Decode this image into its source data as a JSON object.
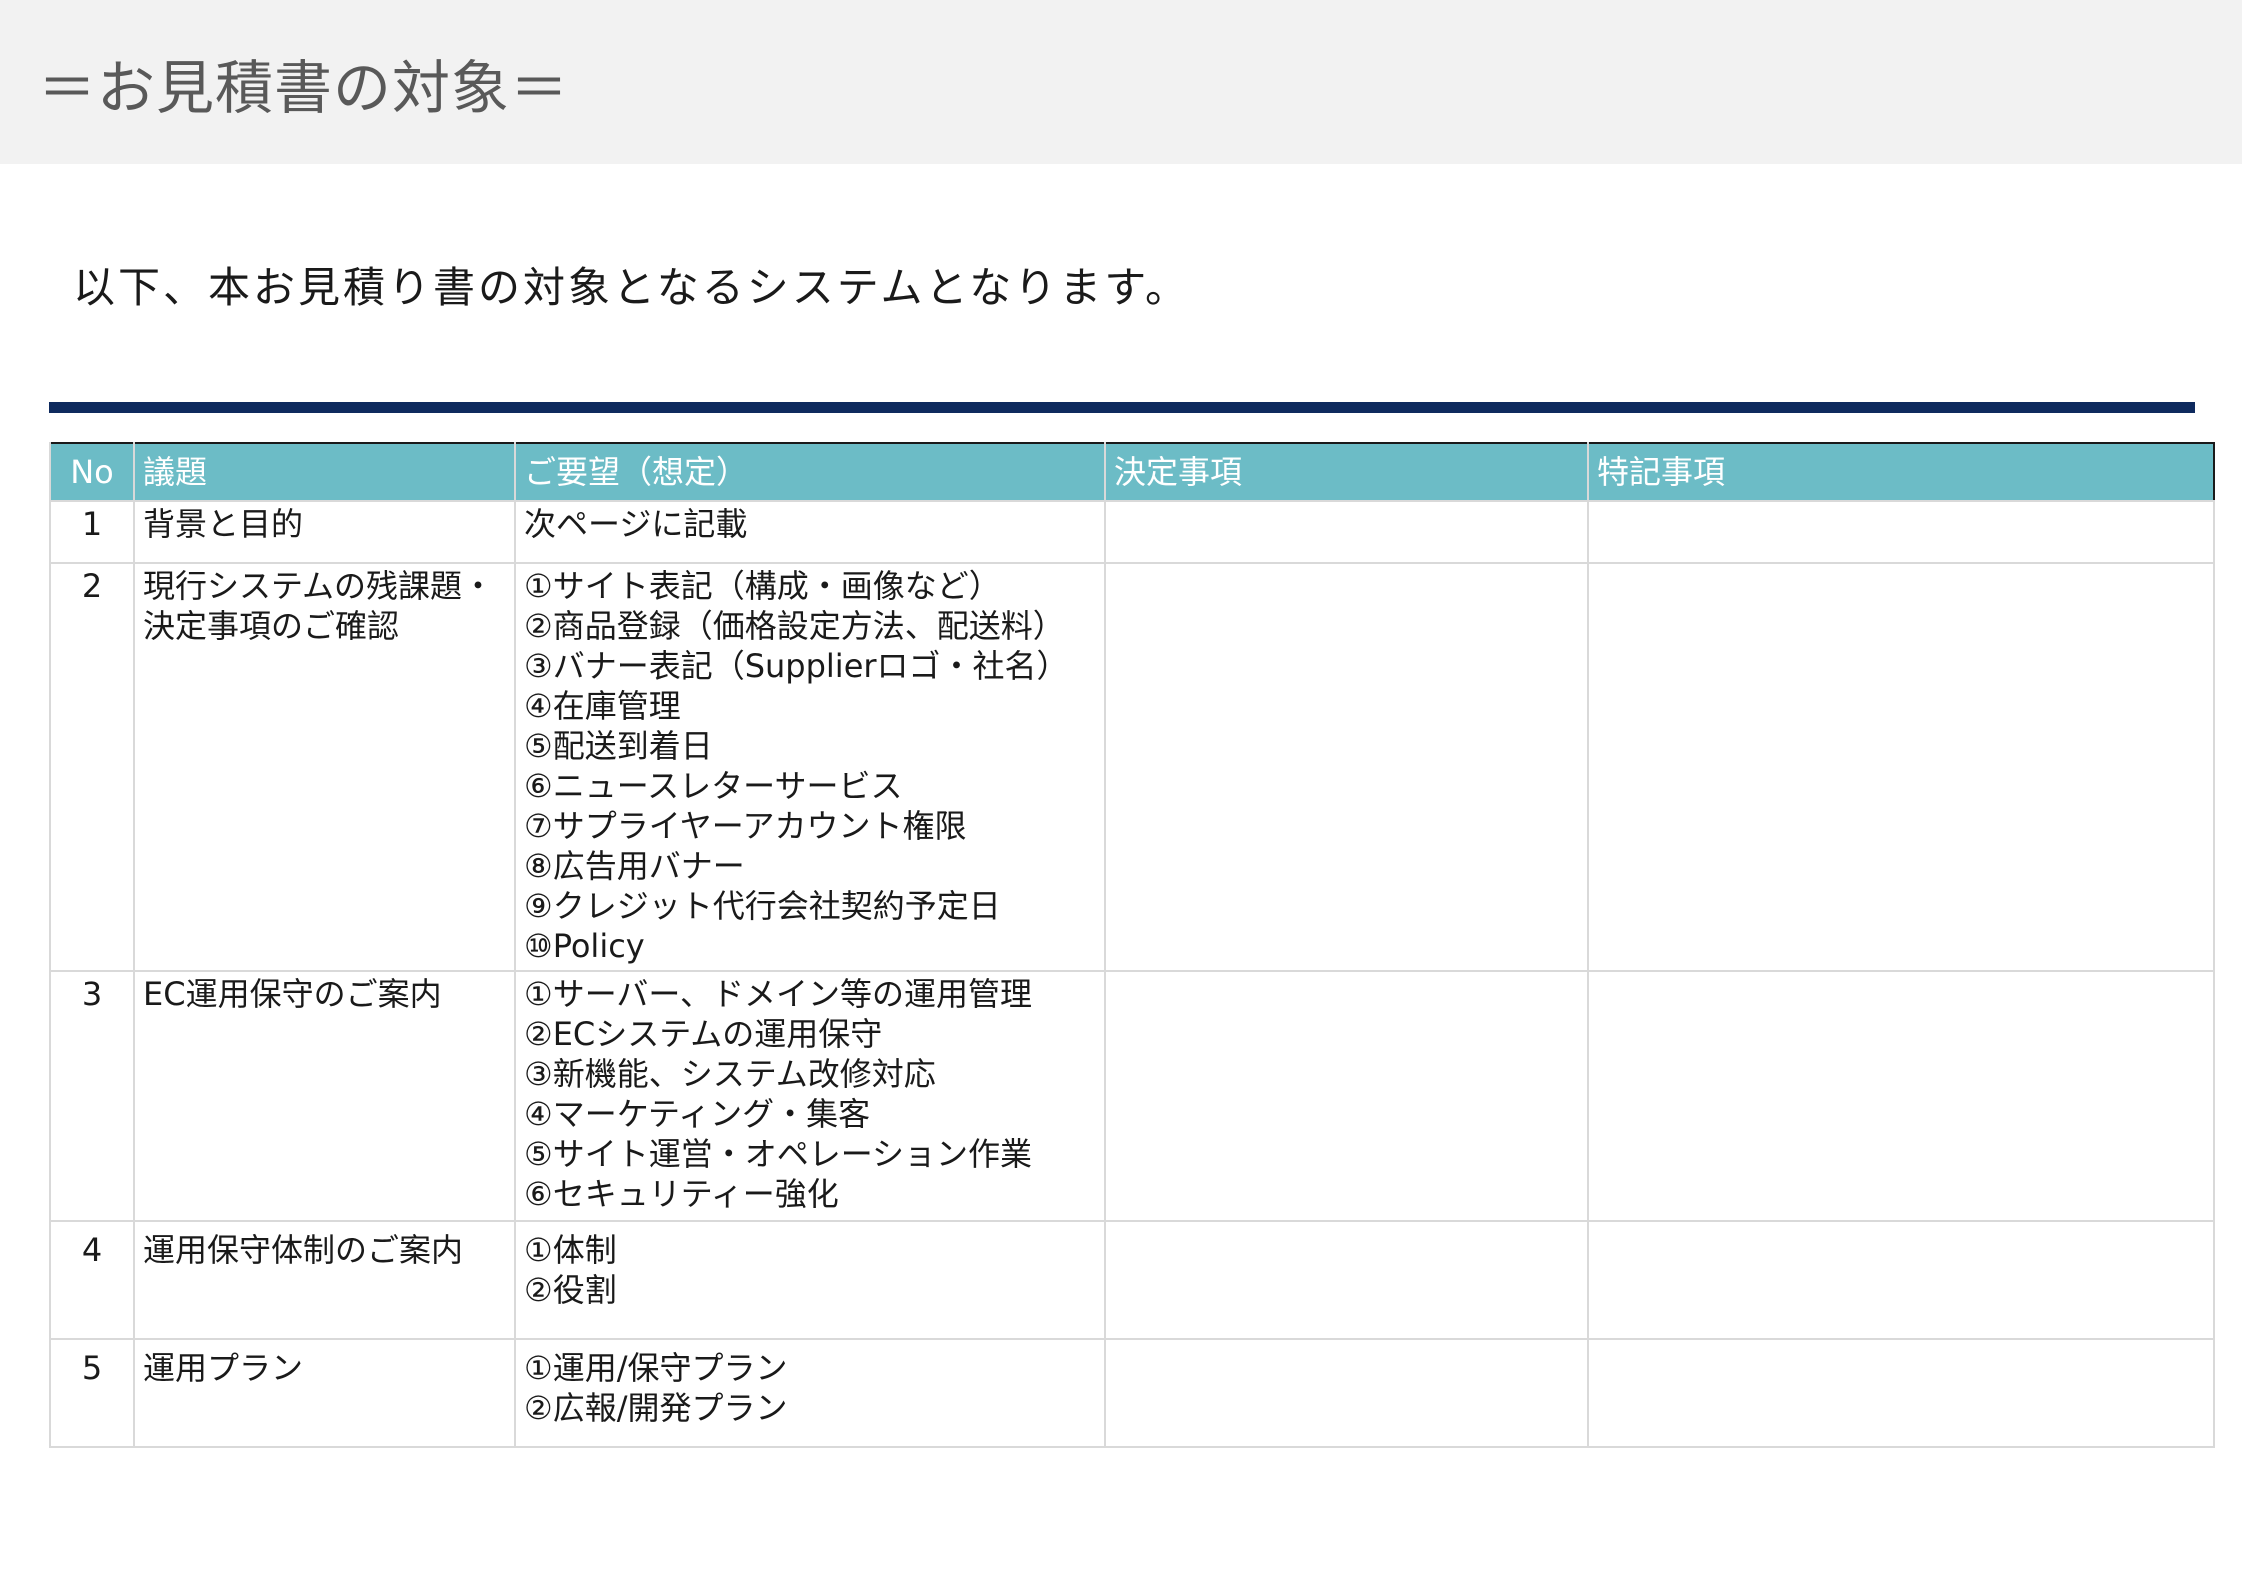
{
  "header": {
    "title": "＝お見積書の対象＝"
  },
  "intro": "以下、本お見積り書の対象となるシステムとなります。",
  "table": {
    "headers": [
      "No",
      "議題",
      "ご要望（想定）",
      "決定事項",
      "特記事項"
    ],
    "rows": [
      {
        "no": "1",
        "topic": [
          "背景と目的"
        ],
        "requests": [
          "次ページに記載"
        ],
        "decisions": "",
        "notes": ""
      },
      {
        "no": "2",
        "topic": [
          "現行システムの残課題・",
          "決定事項のご確認"
        ],
        "requests": [
          "①サイト表記（構成・画像など）",
          "②商品登録（価格設定方法、配送料）",
          "③バナー表記（Supplierロゴ・社名）",
          "④在庫管理",
          "⑤配送到着日",
          "⑥ニュースレターサービス",
          "⑦サプライヤーアカウント権限",
          "⑧広告用バナー",
          "⑨クレジット代行会社契約予定日",
          "⑩Policy"
        ],
        "decisions": "",
        "notes": ""
      },
      {
        "no": "3",
        "topic": [
          "EC運用保守のご案内"
        ],
        "requests": [
          "①サーバー、ドメイン等の運用管理",
          "②ECシステムの運用保守",
          "③新機能、システム改修対応",
          "④マーケティング・集客",
          "⑤サイト運営・オペレーション作業",
          "⑥セキュリティー強化"
        ],
        "decisions": "",
        "notes": ""
      },
      {
        "no": "4",
        "topic": [
          "運用保守体制のご案内"
        ],
        "requests": [
          "①体制",
          "②役割"
        ],
        "decisions": "",
        "notes": ""
      },
      {
        "no": "5",
        "topic": [
          "運用プラン"
        ],
        "requests": [
          "①運用/保守プラン",
          "②広報/開発プラン"
        ],
        "decisions": "",
        "notes": ""
      }
    ]
  },
  "colors": {
    "header_band": "#f2f2f2",
    "title_text": "#595959",
    "accent_rule": "#0e2a5e",
    "table_header": "#6cbcc6"
  }
}
